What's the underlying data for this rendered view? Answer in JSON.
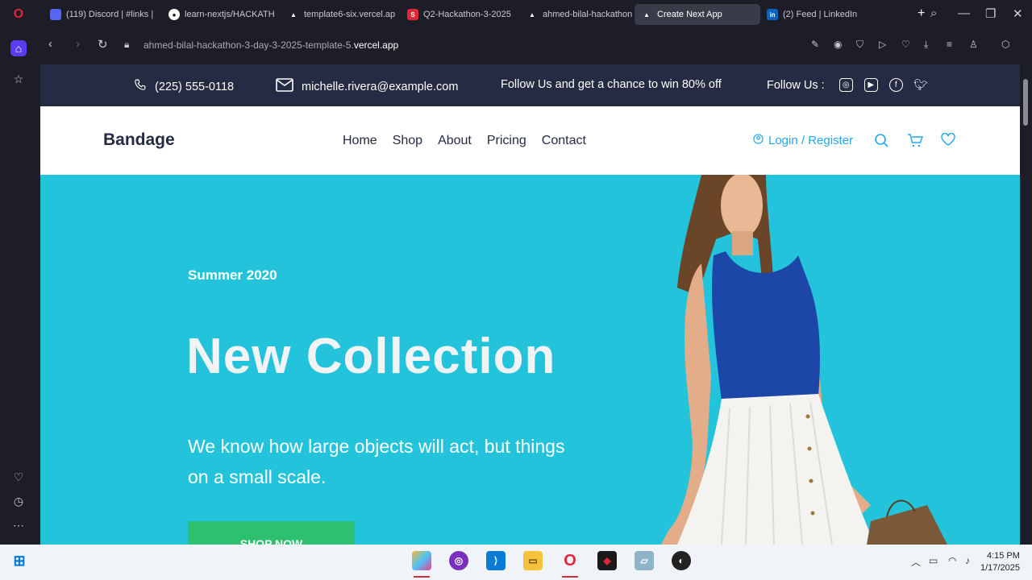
{
  "browser": {
    "tabs": [
      {
        "label": "(119) Discord | #links | ",
        "badge": "119"
      },
      {
        "label": "learn-nextjs/HACKATH"
      },
      {
        "label": "template6-six.vercel.ap"
      },
      {
        "label": "Q2-Hackathon-3-2025"
      },
      {
        "label": "ahmed-bilal-hackathon"
      },
      {
        "label": "Create Next App"
      },
      {
        "label": "(2) Feed | LinkedIn"
      }
    ],
    "url_prefix": "ahmed-bilal-hackathon-3-day-3-2025-template-5.",
    "url_domain": "vercel.app"
  },
  "topbar": {
    "phone": "(225) 555-0118",
    "email": "michelle.rivera@example.com",
    "promo": "Follow Us  and get a chance to win 80% off",
    "follow": "Follow Us  :"
  },
  "header": {
    "brand": "Bandage",
    "menu": [
      "Home",
      "Shop",
      "About",
      "Pricing",
      "Contact"
    ],
    "login": "Login / Register"
  },
  "hero": {
    "season": "Summer 2020",
    "title": "New Collection",
    "subtitle": "We know how large objects will act, but things on a small scale.",
    "button": "SHOP NOW"
  },
  "taskbar": {
    "time": "4:15 PM",
    "date": "1/17/2025"
  },
  "colors": {
    "hero_bg": "#23c4db",
    "topbar_bg": "#252b42",
    "accent": "#23a6f0",
    "button_green": "#2dc071"
  }
}
